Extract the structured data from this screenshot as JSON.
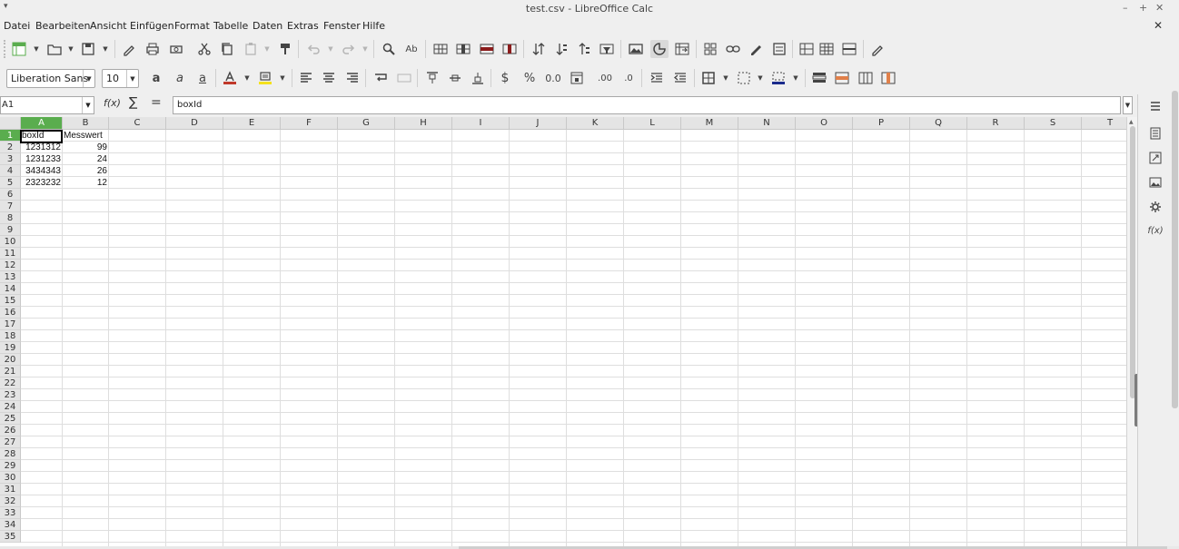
{
  "window": {
    "title": "test.csv - LibreOffice Calc",
    "menu_glyph": "▾",
    "minimize": "–",
    "maximize": "+",
    "close": "✕"
  },
  "menubar": {
    "items": [
      "Datei",
      "Bearbeiten",
      "Ansicht",
      "Einfügen",
      "Format",
      "Tabelle",
      "Daten",
      "Extras",
      "Fenster",
      "Hilfe"
    ],
    "close_doc": "✕"
  },
  "toolbar_format": {
    "font_name": "Liberation Sans",
    "font_size": "10",
    "bold": "a",
    "italic": "a",
    "underline": "a",
    "currency": "$",
    "percent": "%",
    "number": "0.0",
    "font_color": "#c0392b",
    "highlight_color": "#f5e11c",
    "border_color": "#1a2b8c"
  },
  "formula_bar": {
    "name_box": "A1",
    "fx_label": "f(x)",
    "sum_label": "∑",
    "equals_label": "=",
    "content": "boxId"
  },
  "sheet": {
    "columns": [
      "A",
      "B",
      "C",
      "D",
      "E",
      "F",
      "G",
      "H",
      "I",
      "J",
      "K",
      "L",
      "M",
      "N",
      "O",
      "P",
      "Q",
      "R",
      "S",
      "T"
    ],
    "rows": [
      "1",
      "2",
      "3",
      "4",
      "5",
      "6",
      "7",
      "8",
      "9",
      "10",
      "11",
      "12",
      "13",
      "14",
      "15",
      "16",
      "17",
      "18",
      "19",
      "20",
      "21",
      "22",
      "23",
      "24",
      "25",
      "26",
      "27",
      "28",
      "29",
      "30",
      "31",
      "32",
      "33",
      "34",
      "35"
    ],
    "selected_cell": "A1",
    "headers": {
      "A": "boxId",
      "B": "Messwert"
    },
    "data": [
      {
        "boxId": "1231312",
        "Messwert": "99"
      },
      {
        "boxId": "1231233",
        "Messwert": "24"
      },
      {
        "boxId": "3434343",
        "Messwert": "26"
      },
      {
        "boxId": "2323232",
        "Messwert": "12"
      }
    ]
  },
  "sidebar": {
    "functions_label": "f(x)"
  }
}
